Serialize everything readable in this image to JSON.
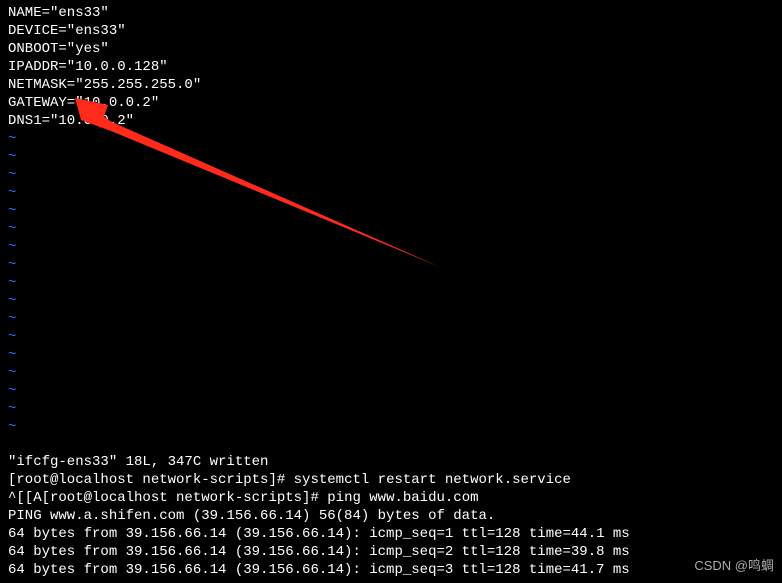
{
  "config": {
    "lines": [
      "NAME=\"ens33\"",
      "DEVICE=\"ens33\"",
      "ONBOOT=\"yes\"",
      "IPADDR=\"10.0.0.128\"",
      "NETMASK=\"255.255.255.0\"",
      "GATEWAY=\"10.0.0.2\"",
      "DNS1=\"10.0.0.2\""
    ]
  },
  "vim": {
    "tilde": "~",
    "tilde_count": 17
  },
  "status": {
    "written": "\"ifcfg-ens33\" 18L, 347C written"
  },
  "shell": {
    "prompt1": "[root@localhost network-scripts]# ",
    "cmd1": "systemctl restart network.service",
    "prompt2": "^[[A[root@localhost network-scripts]# ",
    "cmd2": "ping www.baidu.com",
    "ping_header": "PING www.a.shifen.com (39.156.66.14) 56(84) bytes of data.",
    "ping_line1": "64 bytes from 39.156.66.14 (39.156.66.14): icmp_seq=1 ttl=128 time=44.1 ms",
    "ping_line2": "64 bytes from 39.156.66.14 (39.156.66.14): icmp_seq=2 ttl=128 time=39.8 ms",
    "ping_line3": "64 bytes from 39.156.66.14 (39.156.66.14): icmp_seq=3 ttl=128 time=41.7 ms"
  },
  "watermark": "CSDN @鸣蜩"
}
